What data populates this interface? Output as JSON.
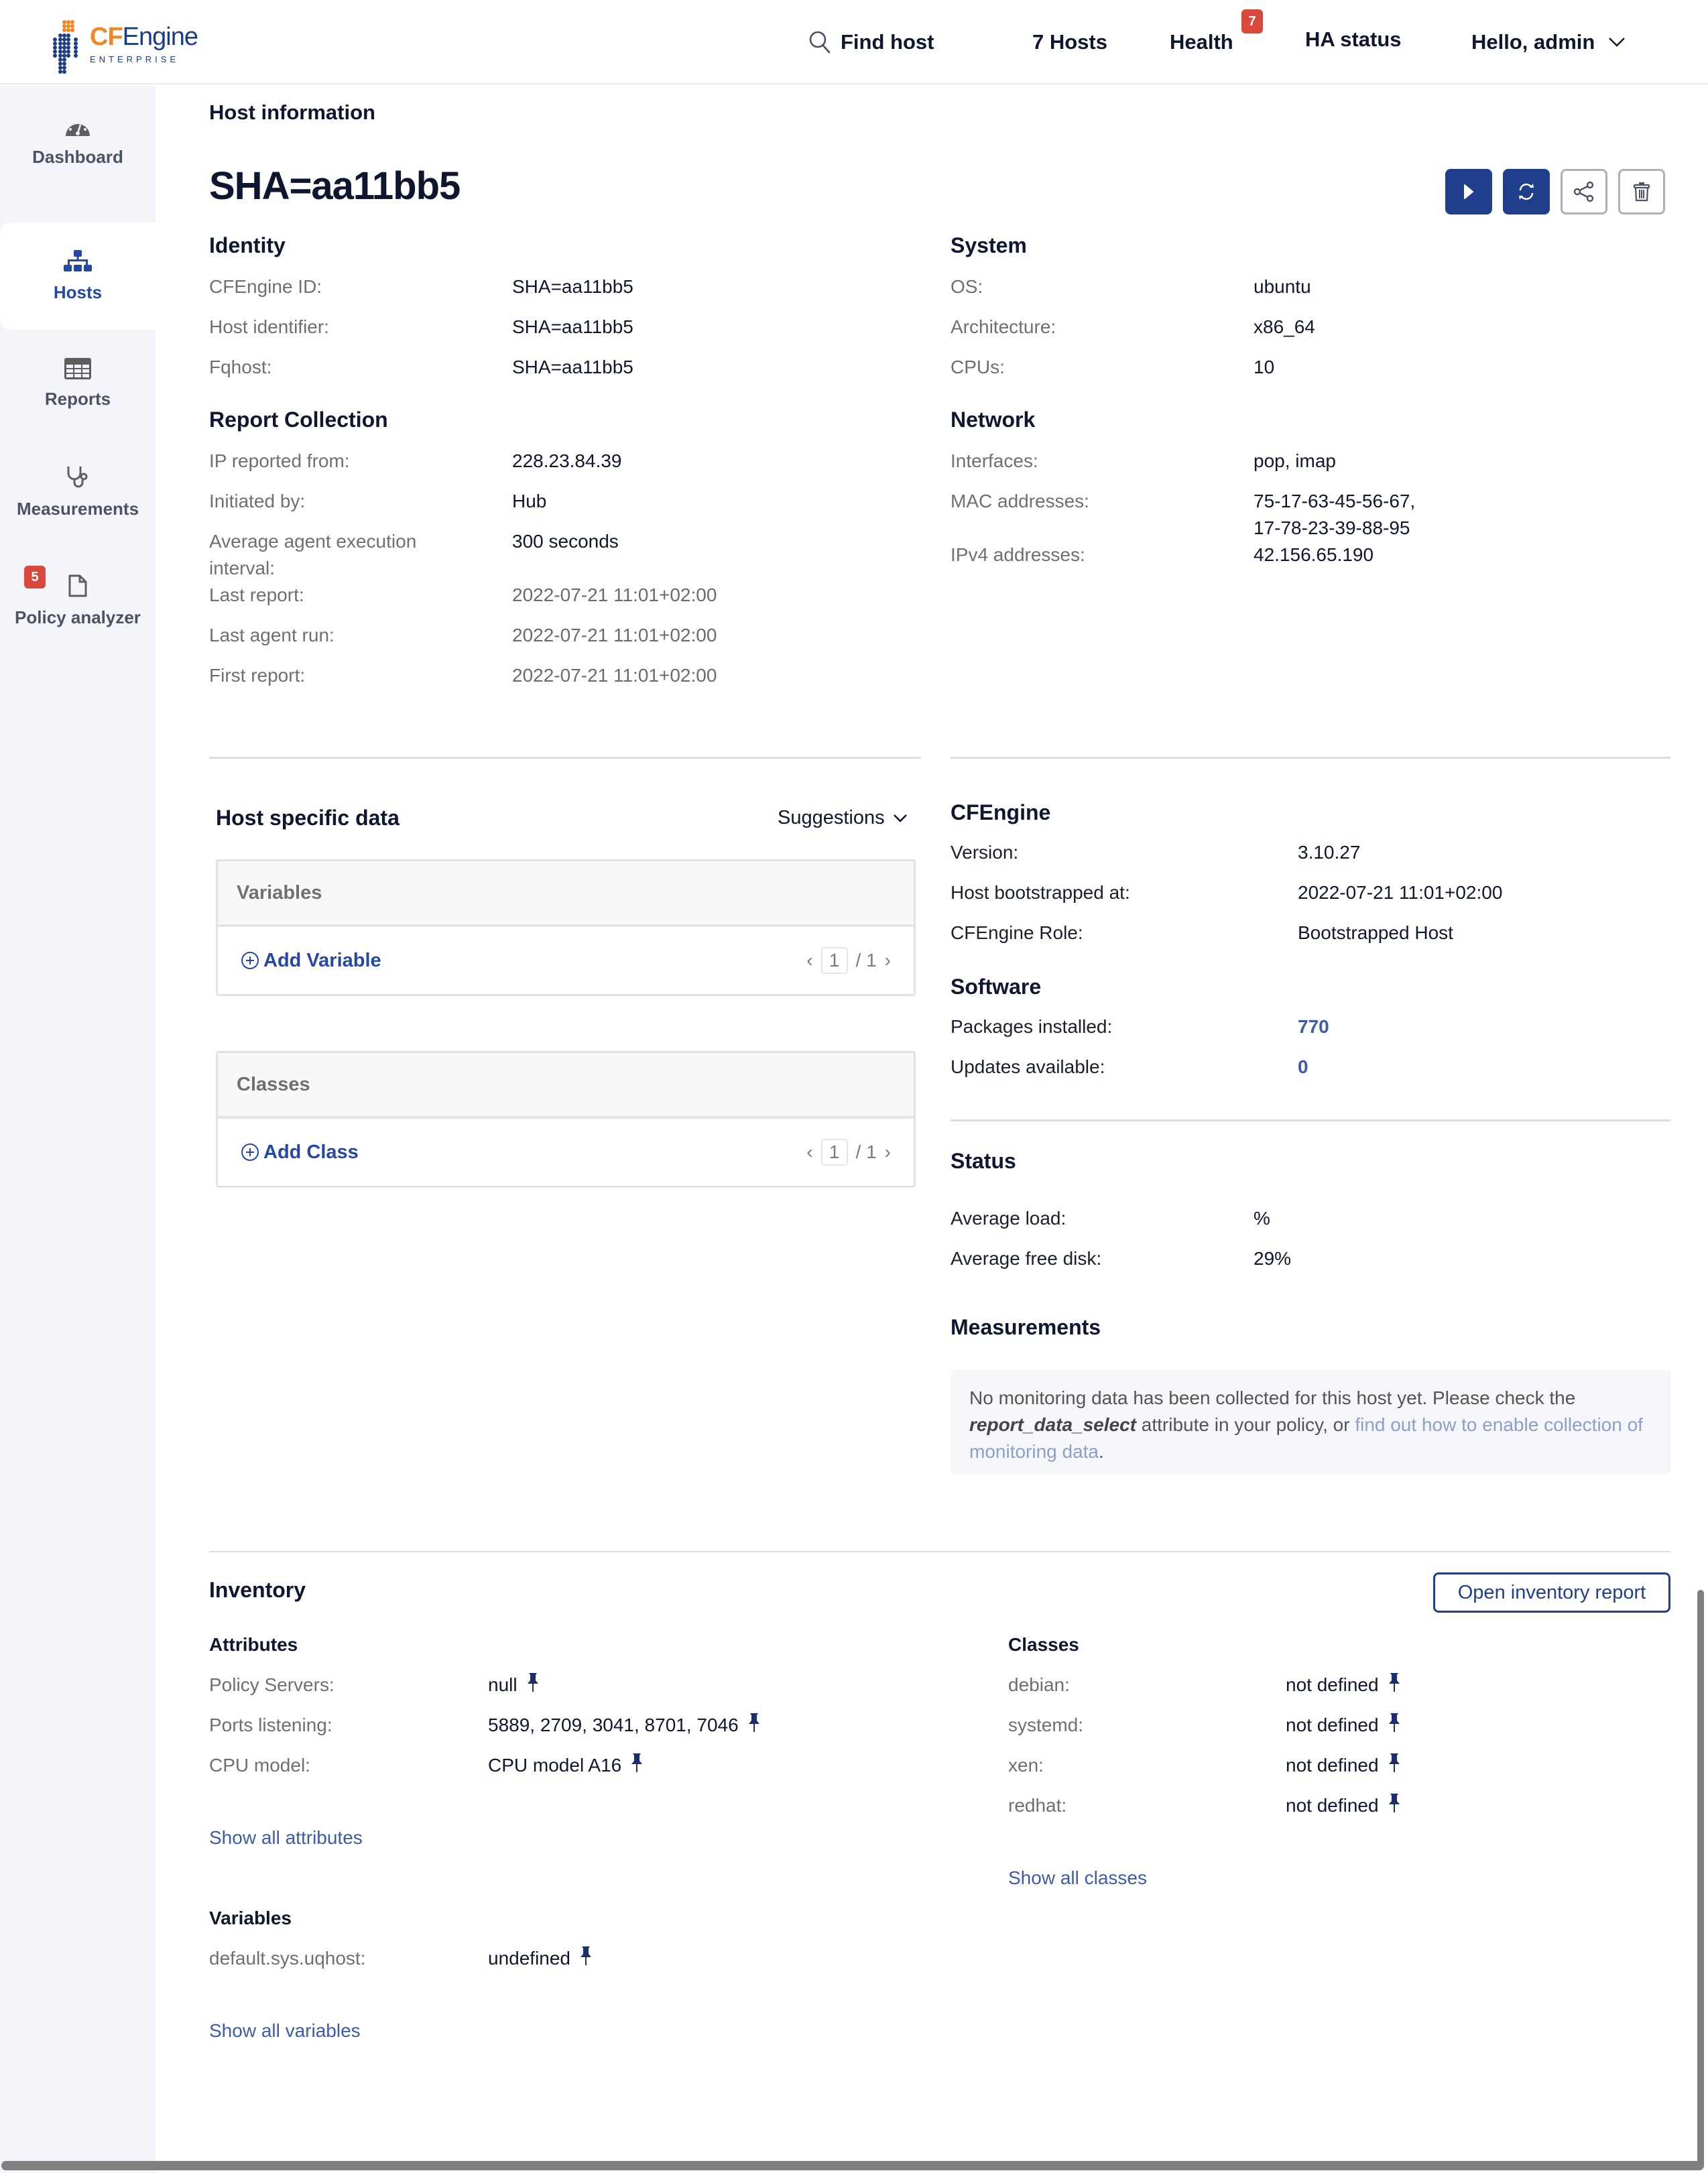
{
  "header": {
    "logo_word_cf": "CF",
    "logo_word_rest": "Engine",
    "logo_sub": "ENTERPRISE",
    "find_host": "Find host",
    "hosts_count": "7 Hosts",
    "health": "Health",
    "health_badge": "7",
    "ha_status": "HA status",
    "user_greeting": "Hello, admin"
  },
  "sidebar": {
    "items": [
      {
        "label": "Dashboard",
        "icon": "dashboard-gauge-icon"
      },
      {
        "label": "Hosts",
        "icon": "hosts-sitemap-icon",
        "active": true
      },
      {
        "label": "Reports",
        "icon": "reports-table-icon"
      },
      {
        "label": "Measurements",
        "icon": "stethoscope-icon"
      },
      {
        "label": "Policy analyzer",
        "icon": "file-icon",
        "badge": "5"
      }
    ]
  },
  "page": {
    "breadcrumb": "Host information",
    "host_title": "SHA=aa11bb5",
    "actions": [
      "run-agent",
      "refresh",
      "share",
      "delete"
    ]
  },
  "identity": {
    "title": "Identity",
    "rows": [
      {
        "k": "CFEngine ID:",
        "v": "SHA=aa11bb5"
      },
      {
        "k": "Host identifier:",
        "v": "SHA=aa11bb5"
      },
      {
        "k": "Fqhost:",
        "v": "SHA=aa11bb5"
      }
    ]
  },
  "report_collection": {
    "title": "Report Collection",
    "rows": [
      {
        "k": "IP reported from:",
        "v": "228.23.84.39"
      },
      {
        "k": "Initiated by:",
        "v": "Hub"
      },
      {
        "k": "Average agent execution",
        "k2": "interval:",
        "v": "300 seconds"
      },
      {
        "k": "Last report:",
        "v": "2022-07-21 11:01+02:00"
      },
      {
        "k": "Last agent run:",
        "v": "2022-07-21 11:01+02:00"
      },
      {
        "k": "First report:",
        "v": "2022-07-21 11:01+02:00"
      }
    ]
  },
  "system": {
    "title": "System",
    "rows": [
      {
        "k": "OS:",
        "v": "ubuntu"
      },
      {
        "k": "Architecture:",
        "v": "x86_64"
      },
      {
        "k": "CPUs:",
        "v": "10"
      }
    ]
  },
  "network": {
    "title": "Network",
    "rows": [
      {
        "k": "Interfaces:",
        "v": "pop, imap"
      },
      {
        "k": "MAC addresses:",
        "v": "75-17-63-45-56-67,",
        "v2": "17-78-23-39-88-95"
      },
      {
        "k": "IPv4 addresses:",
        "v": "42.156.65.190"
      }
    ]
  },
  "host_specific": {
    "title": "Host specific data",
    "suggestions": "Suggestions",
    "variables_panel": {
      "title": "Variables",
      "add": "Add Variable",
      "page": "1",
      "of": "/ 1"
    },
    "classes_panel": {
      "title": "Classes",
      "add": "Add Class",
      "page": "1",
      "of": "/ 1"
    }
  },
  "cfengine": {
    "title": "CFEngine",
    "rows": [
      {
        "k": "Version:",
        "v": "3.10.27"
      },
      {
        "k": "Host bootstrapped at:",
        "v": "2022-07-21 11:01+02:00"
      },
      {
        "k": "CFEngine Role:",
        "v": "Bootstrapped Host"
      }
    ]
  },
  "software": {
    "title": "Software",
    "rows": [
      {
        "k": "Packages installed:",
        "v": "770"
      },
      {
        "k": "Updates available:",
        "v": "0"
      }
    ]
  },
  "status": {
    "title": "Status",
    "rows": [
      {
        "k": "Average load:",
        "v": "%"
      },
      {
        "k": "Average free disk:",
        "v": "29%"
      }
    ]
  },
  "measurements": {
    "title": "Measurements",
    "msg_part1": "No monitoring data has been collected for this host yet. Please check the ",
    "msg_em": "report_data_select",
    "msg_part2": " attribute in your policy, or ",
    "msg_link": "find out how to enable collection of monitoring data",
    "msg_end": "."
  },
  "inventory": {
    "title": "Inventory",
    "open_report": "Open inventory report",
    "attributes": {
      "title": "Attributes",
      "rows": [
        {
          "k": "Policy Servers:",
          "v": "null"
        },
        {
          "k": "Ports listening:",
          "v": "5889, 2709, 3041, 8701, 7046"
        },
        {
          "k": "CPU model:",
          "v": "CPU model A16"
        }
      ],
      "show_all": "Show all attributes"
    },
    "classes": {
      "title": "Classes",
      "rows": [
        {
          "k": "debian:",
          "v": "not defined"
        },
        {
          "k": "systemd:",
          "v": "not defined"
        },
        {
          "k": "xen:",
          "v": "not defined"
        },
        {
          "k": "redhat:",
          "v": "not defined"
        }
      ],
      "show_all": "Show all classes"
    },
    "variables": {
      "title": "Variables",
      "rows": [
        {
          "k": "default.sys.uqhost:",
          "v": "undefined"
        }
      ],
      "show_all": "Show all variables"
    }
  },
  "colors": {
    "brand_blue": "#1f3f8c",
    "brand_orange": "#f5861f",
    "badge_red": "#d9483b",
    "link_blue": "#3d5ba8"
  }
}
